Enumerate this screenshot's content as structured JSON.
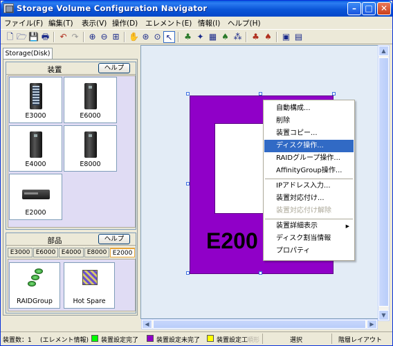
{
  "window": {
    "title": "Storage Volume Configuration Navigator"
  },
  "menu": [
    "ファイル(F)",
    "編集(T)",
    "表示(V)",
    "操作(D)",
    "エレメント(E)",
    "情報(I)",
    "ヘルプ(H)"
  ],
  "tab": "Storage(Disk)",
  "devices": {
    "title": "装置",
    "help": "ヘルプ",
    "items": [
      "E3000",
      "E6000",
      "E4000",
      "E8000",
      "E2000"
    ]
  },
  "parts": {
    "title": "部品",
    "help": "ヘルプ",
    "tabs": [
      "E3000",
      "E6000",
      "E4000",
      "E8000",
      "E2000"
    ],
    "active_tab": "E2000",
    "items": [
      "RAIDGroup",
      "Hot Spare"
    ]
  },
  "canvas": {
    "device_label": "E200"
  },
  "context_menu": [
    {
      "label": "自動構成...",
      "state": "normal"
    },
    {
      "label": "削除",
      "state": "normal"
    },
    {
      "label": "装置コピー...",
      "state": "normal"
    },
    {
      "label": "ディスク操作...",
      "state": "selected"
    },
    {
      "label": "RAIDグループ操作...",
      "state": "normal"
    },
    {
      "label": "AffinityGroup操作...",
      "state": "normal"
    },
    {
      "label": "IPアドレス入力...",
      "state": "normal"
    },
    {
      "label": "装置対応付け...",
      "state": "normal"
    },
    {
      "label": "装置対応付け解除",
      "state": "disabled"
    },
    {
      "label": "装置詳細表示",
      "state": "submenu"
    },
    {
      "label": "ディスク割当情報",
      "state": "normal"
    },
    {
      "label": "プロパティ",
      "state": "normal"
    }
  ],
  "status": {
    "count": "装置数：1",
    "info": "(エレメント情報)",
    "legend": [
      {
        "label": "装置設定完了",
        "color": "#00ff00"
      },
      {
        "label": "装置設定未完了",
        "color": "#9000c8"
      },
      {
        "label": "装置設定工",
        "color": "#ffff00"
      }
    ],
    "faint": "順形",
    "mode": "選択",
    "layout": "階層レイアウト"
  }
}
